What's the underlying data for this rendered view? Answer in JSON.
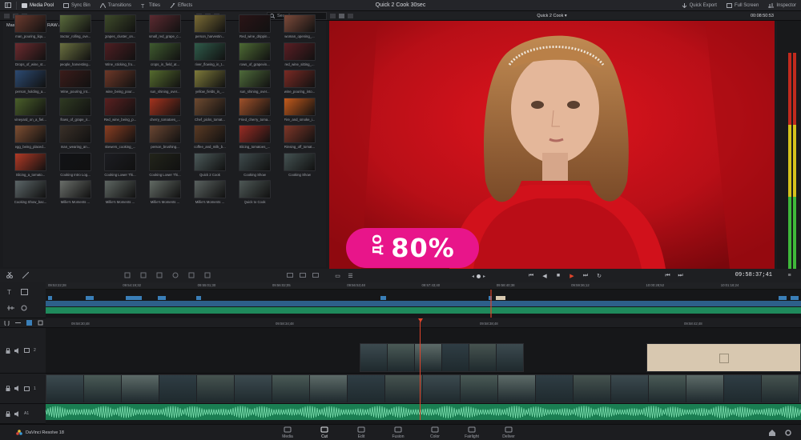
{
  "topbar": {
    "items": [
      {
        "label": "Media Pool",
        "icon": "media-pool-icon"
      },
      {
        "label": "Sync Bin",
        "icon": "sync-bin-icon"
      },
      {
        "label": "Transitions",
        "icon": "transitions-icon"
      },
      {
        "label": "Titles",
        "icon": "titles-icon"
      },
      {
        "label": "Effects",
        "icon": "effects-icon"
      }
    ],
    "project_title": "Quick 2 Cook 30sec",
    "right_items": [
      {
        "label": "Quick Export",
        "icon": "export-icon"
      },
      {
        "label": "Full Screen",
        "icon": "fullscreen-icon"
      },
      {
        "label": "Inspector",
        "icon": "inspector-icon"
      }
    ]
  },
  "subbar": {
    "search_placeholder": "Search",
    "timeline_name": "Quick 2 Cook",
    "source_timecode": "00:08:50:53"
  },
  "media_pool": {
    "breadcrumb": "Master / Blackmagic RAW / B Roll",
    "clips": [
      {
        "label": "man_pouring_liqu...",
        "color": "#6b3a2e"
      },
      {
        "label": "tractor_rolling_ove...",
        "color": "#5a6b3c"
      },
      {
        "label": "grapes_cluster_on...",
        "color": "#3e4a2a"
      },
      {
        "label": "small_red_grape_c...",
        "color": "#5b2a30"
      },
      {
        "label": "person_harvestin...",
        "color": "#7a6b35"
      },
      {
        "label": "Red_wine_drippin...",
        "color": "#2a1416"
      },
      {
        "label": "woman_opening_...",
        "color": "#7c4a3a"
      },
      {
        "label": "Drops_of_wine_st...",
        "color": "#6c2b2f"
      },
      {
        "label": "people_harvesting...",
        "color": "#6a7040"
      },
      {
        "label": "Wine_sticking_fro...",
        "color": "#4e1e22"
      },
      {
        "label": "crops_in_field_at...",
        "color": "#3f5a2f"
      },
      {
        "label": "river_flowing_in_t...",
        "color": "#2f5b4a"
      },
      {
        "label": "rows_of_grapevin...",
        "color": "#4d6a34"
      },
      {
        "label": "red_wine_sitting_...",
        "color": "#5a1e24"
      },
      {
        "label": "person_holding_a...",
        "color": "#2c4a72"
      },
      {
        "label": "Wine_pouring_int...",
        "color": "#3b1c1a"
      },
      {
        "label": "wine_being_pour...",
        "color": "#6e3828"
      },
      {
        "label": "sun_shining_over...",
        "color": "#556b2e"
      },
      {
        "label": "yellow_fields_in_...",
        "color": "#7e7a3a"
      },
      {
        "label": "sun_shining_over...",
        "color": "#4e6a3a"
      },
      {
        "label": "wine_pouring_into...",
        "color": "#7a2a24"
      },
      {
        "label": "vineyard_on_a_fiel...",
        "color": "#4a5f2a"
      },
      {
        "label": "flows_of_grape_ir...",
        "color": "#2f3a22"
      },
      {
        "label": "Red_wine_being_p...",
        "color": "#5a2020"
      },
      {
        "label": "cherry_tomatoes_...",
        "color": "#a5331e"
      },
      {
        "label": "Chef_picks_tomat...",
        "color": "#6e4a30"
      },
      {
        "label": "Fried_cherry_toma...",
        "color": "#a0512a"
      },
      {
        "label": "Fire_and_smoke_i...",
        "color": "#c35a1c"
      },
      {
        "label": "egg_being_placed...",
        "color": "#7e4e32"
      },
      {
        "label": "man_wearing_an...",
        "color": "#3a3028"
      },
      {
        "label": "skewers_cooking_...",
        "color": "#8a3e22"
      },
      {
        "label": "person_brushing...",
        "color": "#6a4632"
      },
      {
        "label": "coffee_and_milk_b...",
        "color": "#5a3a24"
      },
      {
        "label": "Slicing_tomatoes_...",
        "color": "#9a2c24"
      },
      {
        "label": "Rinsing_off_tomat...",
        "color": "#7e3628"
      },
      {
        "label": "Slicing_a_tomato...",
        "color": "#b23a26"
      },
      {
        "label": "Cooking Intro Log...",
        "color": "#111216"
      },
      {
        "label": "Cooking Lower Thi...",
        "color": "#1c1d22"
      },
      {
        "label": "Cooking Lower Thi...",
        "color": "#22241a"
      },
      {
        "label": "Quick 2 Cook",
        "color": "#4c5a5a"
      },
      {
        "label": "Cooking Show",
        "color": "#3e4a4c"
      },
      {
        "label": "Cooking Show",
        "color": "#445252"
      },
      {
        "label": "Cooking Show_bac...",
        "color": "#5c6668"
      },
      {
        "label": "Millie's Moments ...",
        "color": "#6a6e6a"
      },
      {
        "label": "Millie's Moments ...",
        "color": "#5e6662"
      },
      {
        "label": "Millie's Moments ...",
        "color": "#626a64"
      },
      {
        "label": "Millie's Moments ...",
        "color": "#5a6260"
      },
      {
        "label": "Quick to Cook",
        "color": "#4e5856"
      }
    ]
  },
  "viewer": {
    "promo_prefix": "ДО",
    "promo_value": "80%",
    "record_timecode": "09:58:37;41"
  },
  "timeline": {
    "mini_ruler": [
      "09:53:22;28",
      "09:54:19;32",
      "09:55:01;30",
      "09:56:02;05",
      "09:56:53;48",
      "09:57:43;40",
      "09:58:40;38",
      "09:59:36;12",
      "10:00:28;52",
      "10:01:18;24"
    ],
    "ruler": [
      "09:58:30;48",
      "09:58:34;48",
      "09:58:38;48",
      "09:58:42;48"
    ],
    "tracks": [
      {
        "label": "2"
      },
      {
        "label": "1"
      },
      {
        "label": "A1"
      }
    ]
  },
  "pages": [
    {
      "label": "Media",
      "icon": "media-page-icon"
    },
    {
      "label": "Cut",
      "icon": "cut-page-icon",
      "active": true
    },
    {
      "label": "Edit",
      "icon": "edit-page-icon"
    },
    {
      "label": "Fusion",
      "icon": "fusion-page-icon"
    },
    {
      "label": "Color",
      "icon": "color-page-icon"
    },
    {
      "label": "Fairlight",
      "icon": "fairlight-page-icon"
    },
    {
      "label": "Deliver",
      "icon": "deliver-page-icon"
    }
  ],
  "app_name": "DaVinci Resolve 18",
  "colors": {
    "accent": "#e8158a",
    "playhead": "#e1452b",
    "audio": "#2bb577",
    "video_clip": "#3a7fb8"
  }
}
